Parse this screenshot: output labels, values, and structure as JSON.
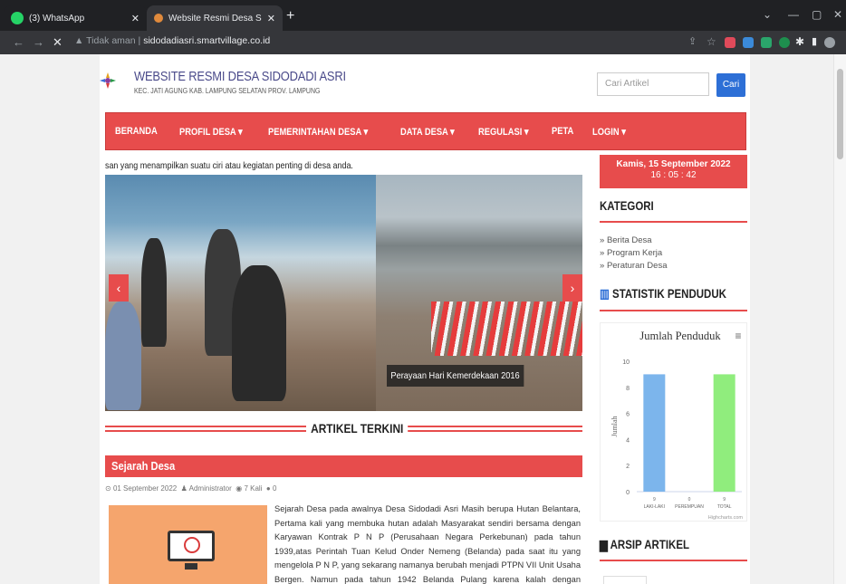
{
  "browser": {
    "tabs": [
      {
        "title": "(3) WhatsApp",
        "active": false
      },
      {
        "title": "Website Resmi Desa Sidodadi As",
        "active": true
      }
    ],
    "omnibox": {
      "security_label": "Tidak aman",
      "host": "sidodadiasri.smartvillage.co.id"
    }
  },
  "site": {
    "brand_title": "WEBSITE RESMI DESA SIDODADI ASRI",
    "brand_subtitle": "KEC. JATI AGUNG KAB. LAMPUNG SELATAN PROV. LAMPUNG",
    "search_placeholder": "Cari Artikel",
    "search_button": "Cari",
    "menu": [
      "BERANDA",
      "PROFIL DESA ▾",
      "PEMERINTAHAN DESA ▾",
      "DATA DESA ▾",
      "REGULASI ▾",
      "PETA",
      "LOGIN ▾"
    ],
    "marquee": "san yang menampilkan suatu ciri atau kegiatan penting di desa anda.",
    "slider_caption": "Perayaan Hari Kemerdekaan 2016",
    "section_title": "ARTIKEL TERKINI",
    "article": {
      "title": "Sejarah Desa",
      "date": "01 September 2022",
      "author": "Administrator",
      "views": "7 Kali",
      "comments": "0",
      "body": "Sejarah Desa pada awalnya Desa Sidodadi Asri Masih berupa Hutan Belantara, Pertama kali yang membuka hutan adalah Masyarakat sendiri bersama dengan Karyawan Kontrak P N P (Perusahaan Negara Perkebunan) pada tahun 1939,atas Perintah Tuan Kelud Onder Nemeng (Belanda) pada saat itu yang mengelola P N P, yang sekarang namanya berubah menjadi PTPN VII Unit Usaha Bergen. Namun pada tahun 1942 Belanda Pulang karena kalah dengan Jepang,sehingga proses membuka hutan untuk"
    },
    "sidebar": {
      "date": "Kamis, 15 September 2022",
      "time": "16 : 05 : 42",
      "kategori_title": "KATEGORI",
      "kategori": [
        "Berita Desa",
        "Program Kerja",
        "Peraturan Desa"
      ],
      "statistik_title": "STATISTIK PENDUDUK",
      "arsip_title": "ARSIP ARTIKEL"
    }
  },
  "chart_data": {
    "type": "bar",
    "title": "Jumlah Penduduk",
    "ylabel": "Jumlah",
    "categories": [
      "LAKI-LAKI",
      "PEREMPUAN",
      "TOTAL"
    ],
    "values": [
      9,
      0,
      9
    ],
    "value_labels": [
      "9",
      "0",
      "9"
    ],
    "colors": [
      "#7cb5ec",
      "#7cb5ec",
      "#90ed7d"
    ],
    "ylim": [
      0,
      10
    ],
    "yticks": [
      0,
      2,
      4,
      6,
      8,
      10
    ],
    "credit": "Highcharts.com",
    "grid": false
  }
}
